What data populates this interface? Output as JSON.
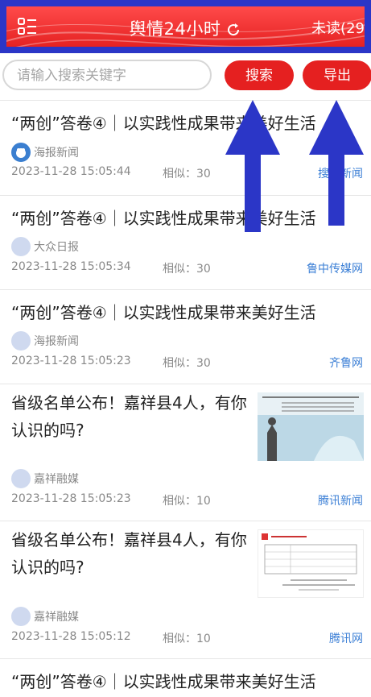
{
  "header": {
    "title": "舆情24小时",
    "unread": "未读(29"
  },
  "search": {
    "placeholder": "请输入搜索关键字",
    "search_label": "搜索",
    "export_label": "导出"
  },
  "items": [
    {
      "title": "“两创”答卷④｜以实践性成果带来美好生活",
      "source": "海报新闻",
      "time": "2023-11-28 15:05:44",
      "similar": "相似：30",
      "site": "搜狐新闻"
    },
    {
      "title": "“两创”答卷④｜以实践性成果带来美好生活",
      "source": "大众日报",
      "time": "2023-11-28 15:05:34",
      "similar": "相似：30",
      "site": "鲁中传媒网"
    },
    {
      "title": "“两创”答卷④｜以实践性成果带来美好生活",
      "source": "海报新闻",
      "time": "2023-11-28 15:05:23",
      "similar": "相似：30",
      "site": "齐鲁网"
    },
    {
      "title": "省级名单公布！嘉祥县4人，有你认识的吗?",
      "source": "嘉祥融媒",
      "time": "2023-11-28 15:05:23",
      "similar": "相似：10",
      "site": "腾讯新闻"
    },
    {
      "title": "省级名单公布！嘉祥县4人，有你认识的吗?",
      "source": "嘉祥融媒",
      "time": "2023-11-28 15:05:12",
      "similar": "相似：10",
      "site": "腾讯网"
    },
    {
      "title": "“两创”答卷④｜以实践性成果带来美好生活"
    }
  ],
  "colors": {
    "header_red": "#e52222",
    "frame_blue": "#2b36c7",
    "button_red": "#e52020",
    "site_blue": "#3d80d6",
    "arrow_blue": "#2b36c7"
  },
  "icons": [
    "menu-icon",
    "refresh-icon",
    "source-avatar-icon",
    "thumbnail-image",
    "annotation-arrow"
  ]
}
